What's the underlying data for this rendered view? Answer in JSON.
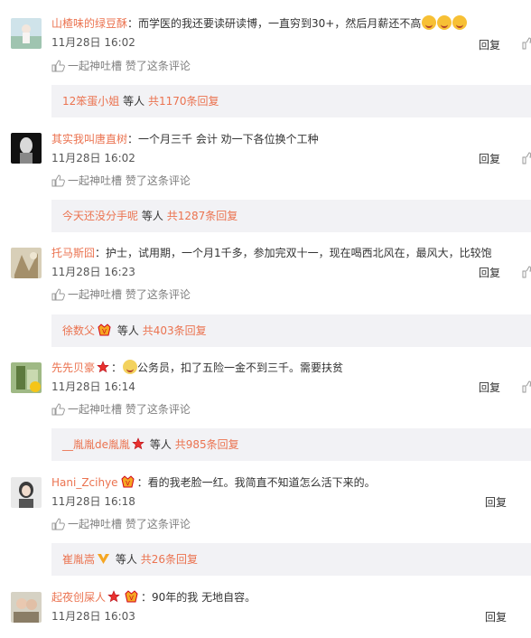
{
  "like_text": "一起神吐槽 赞了这条评论",
  "reply_label": "回复",
  "comments": [
    {
      "username": "山楂味的绿豆酥",
      "text": "：而学医的我还要读研读博，一直穷到30+，然后月薪还不高",
      "time": "11月28日  16:02",
      "sub_user": "12笨蛋小姐",
      "sub_people": "等人",
      "sub_count": "共1170条回复"
    },
    {
      "username": "其实我叫唐直树",
      "text": "：一个月三千 会计 劝一下各位换个工种",
      "time": "11月28日  16:02",
      "sub_user": "今天还没分手呢",
      "sub_people": "等人",
      "sub_count": "共1287条回复"
    },
    {
      "username": "托马斯囧",
      "text": "：护士，试用期，一个月1千多，参加完双十一，现在喝西北风在，最风大，比较饱",
      "time": "11月28日  16:23",
      "sub_user": "徐数父",
      "sub_people": "等人",
      "sub_count": "共403条回复"
    },
    {
      "username": "先先贝豪",
      "text": "公务员，扣了五险一金不到三千。需要扶贫",
      "time": "11月28日  16:14",
      "sub_user": "__胤胤de胤胤",
      "sub_people": "等人",
      "sub_count": "共985条回复"
    },
    {
      "username": "Hani_Zcihye",
      "text": "看的我老脸一红。我简直不知道怎么活下来的。",
      "time": "11月28日  16:18",
      "sub_user": "崔胤嵩",
      "sub_people": "等人",
      "sub_count": "共26条回复"
    },
    {
      "username": "起夜创屎人",
      "text": "90年的我 无地自容。",
      "time": "11月28日  16:03"
    }
  ],
  "colors": {
    "username": "#eb7350",
    "subbox_bg": "#f2f2f5",
    "muted": "#808080"
  },
  "icons": [
    "thumbs-up-icon",
    "vip-badge-icon",
    "star-badge-icon",
    "emoji-icon"
  ]
}
